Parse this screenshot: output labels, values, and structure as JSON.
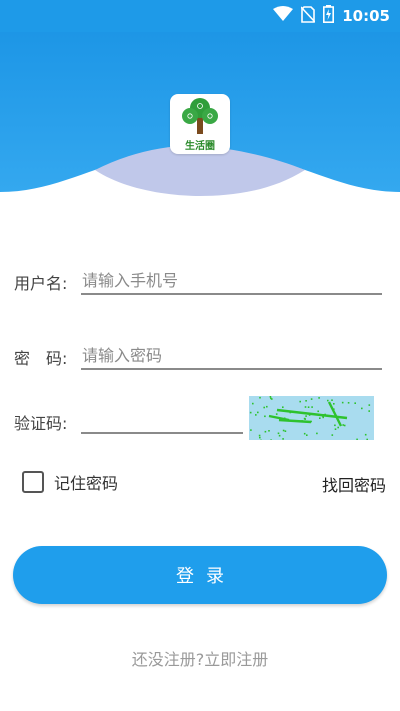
{
  "status_bar": {
    "time": "10:05",
    "icons": [
      "wifi-icon",
      "no-sim-icon",
      "battery-charging-icon"
    ]
  },
  "logo": {
    "text": "生活圈"
  },
  "form": {
    "username": {
      "label": "用户名:",
      "placeholder": "请输入手机号",
      "value": ""
    },
    "password": {
      "label": "密　码:",
      "placeholder": "请输入密码",
      "value": ""
    },
    "captcha": {
      "label": "验证码:",
      "value": ""
    }
  },
  "remember": {
    "label": "记住密码",
    "checked": false
  },
  "forgot_label": "找回密码",
  "login_label": "登录",
  "register_label": "还没注册?立即注册",
  "colors": {
    "primary": "#1f9eec",
    "status_bar": "#1e9ae8",
    "wave_light": "#c0c8ea",
    "captcha_bg": "#a9dcef",
    "captcha_line": "#2ec22e"
  }
}
